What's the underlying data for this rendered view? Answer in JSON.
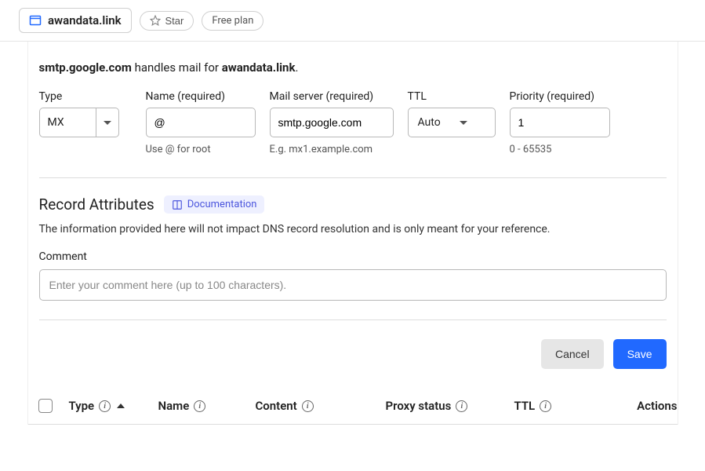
{
  "topbar": {
    "site_name": "awandata.link",
    "star_label": "Star",
    "plan_label": "Free plan"
  },
  "form": {
    "summary_prefix_server": "smtp.google.com",
    "summary_mid": " handles mail for ",
    "summary_domain": "awandata.link",
    "summary_suffix": ".",
    "type": {
      "label": "Type",
      "value": "MX"
    },
    "name": {
      "label": "Name (required)",
      "value": "@",
      "help": "Use @ for root"
    },
    "mailserver": {
      "label": "Mail server (required)",
      "value": "smtp.google.com",
      "help": "E.g. mx1.example.com"
    },
    "ttl": {
      "label": "TTL",
      "value": "Auto"
    },
    "priority": {
      "label": "Priority (required)",
      "value": "1",
      "help": "0 - 65535"
    }
  },
  "attributes": {
    "title": "Record Attributes",
    "doc_label": "Documentation",
    "desc": "The information provided here will not impact DNS record resolution and is only meant for your reference.",
    "comment_label": "Comment",
    "comment_placeholder": "Enter your comment here (up to 100 characters)."
  },
  "actions": {
    "cancel": "Cancel",
    "save": "Save"
  },
  "table": {
    "type": "Type",
    "name": "Name",
    "content": "Content",
    "proxy": "Proxy status",
    "ttl": "TTL",
    "actions": "Actions"
  }
}
